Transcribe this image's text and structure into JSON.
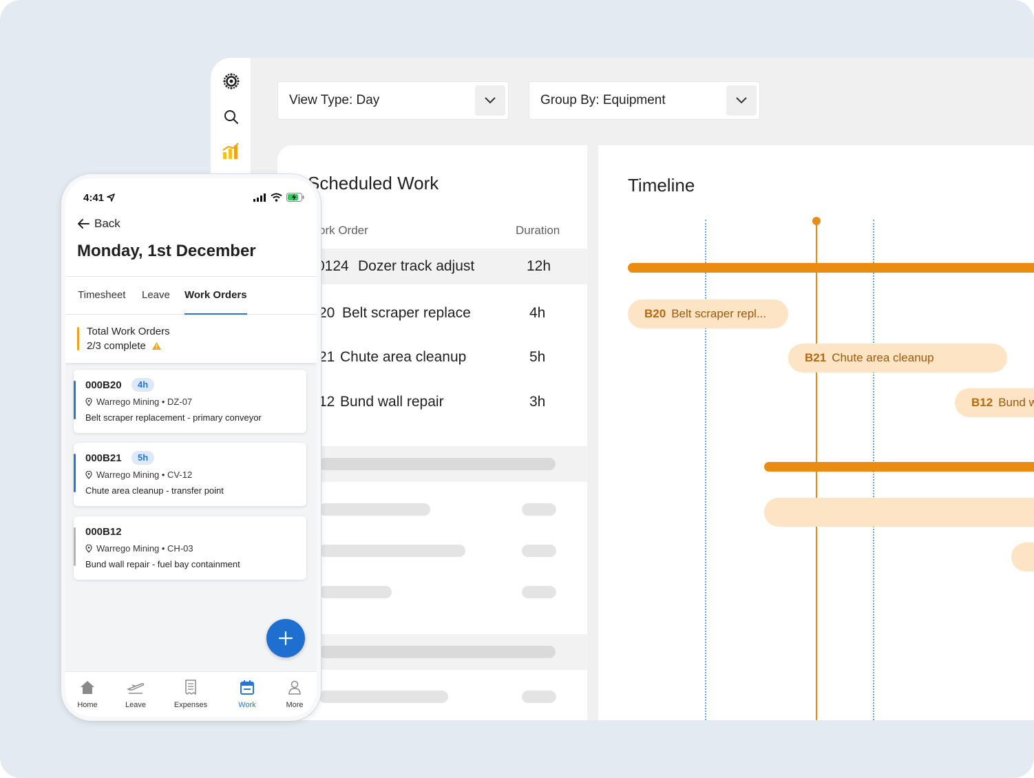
{
  "desktop": {
    "view_type": "View Type: Day",
    "group_by": "Group By: Equipment",
    "scheduled": {
      "title": "Scheduled Work",
      "col_work_order": "ork Order",
      "col_duration": "Duration",
      "rows": [
        {
          "id": "0124",
          "desc": "Dozer track adjust",
          "duration": "12h"
        },
        {
          "id": "20",
          "desc": "Belt scraper replace",
          "duration": "4h"
        },
        {
          "id": "21",
          "desc": "Chute area cleanup",
          "duration": "5h"
        },
        {
          "id": "12",
          "desc": "Bund wall repair",
          "duration": "3h"
        }
      ]
    },
    "timeline": {
      "title": "Timeline",
      "items": [
        {
          "id": "B20",
          "desc": "Belt scraper repl..."
        },
        {
          "id": "B21",
          "desc": "Chute area cleanup"
        },
        {
          "id": "B12",
          "desc": "Bund w"
        }
      ]
    }
  },
  "phone": {
    "time": "4:41",
    "back": "Back",
    "date": "Monday, 1st December",
    "tabs": [
      "Timesheet",
      "Leave",
      "Work Orders"
    ],
    "summary": {
      "title": "Total Work Orders",
      "status": "2/3 complete"
    },
    "cards": [
      {
        "id": "000B20",
        "badge": "4h",
        "location": "Warrego Mining • DZ-07",
        "desc": "Belt scraper replacement - primary conveyor",
        "accent": "#2a74d2"
      },
      {
        "id": "000B21",
        "badge": "5h",
        "location": "Warrego Mining • CV-12",
        "desc": "Chute area cleanup - transfer point",
        "accent": "#2a74d2"
      },
      {
        "id": "000B12",
        "badge": "",
        "location": "Warrego Mining • CH-03",
        "desc": "Bund wall repair - fuel bay containment",
        "accent": "#b5b5b5"
      }
    ],
    "nav": [
      {
        "label": "Home",
        "icon": "home-icon"
      },
      {
        "label": "Leave",
        "icon": "plane-icon"
      },
      {
        "label": "Expenses",
        "icon": "receipt-icon"
      },
      {
        "label": "Work",
        "icon": "calendar-icon"
      },
      {
        "label": "More",
        "icon": "person-icon"
      }
    ]
  },
  "colors": {
    "accent": "#ea8c12",
    "primary": "#2a74d2",
    "pill": "#fde4c4"
  }
}
